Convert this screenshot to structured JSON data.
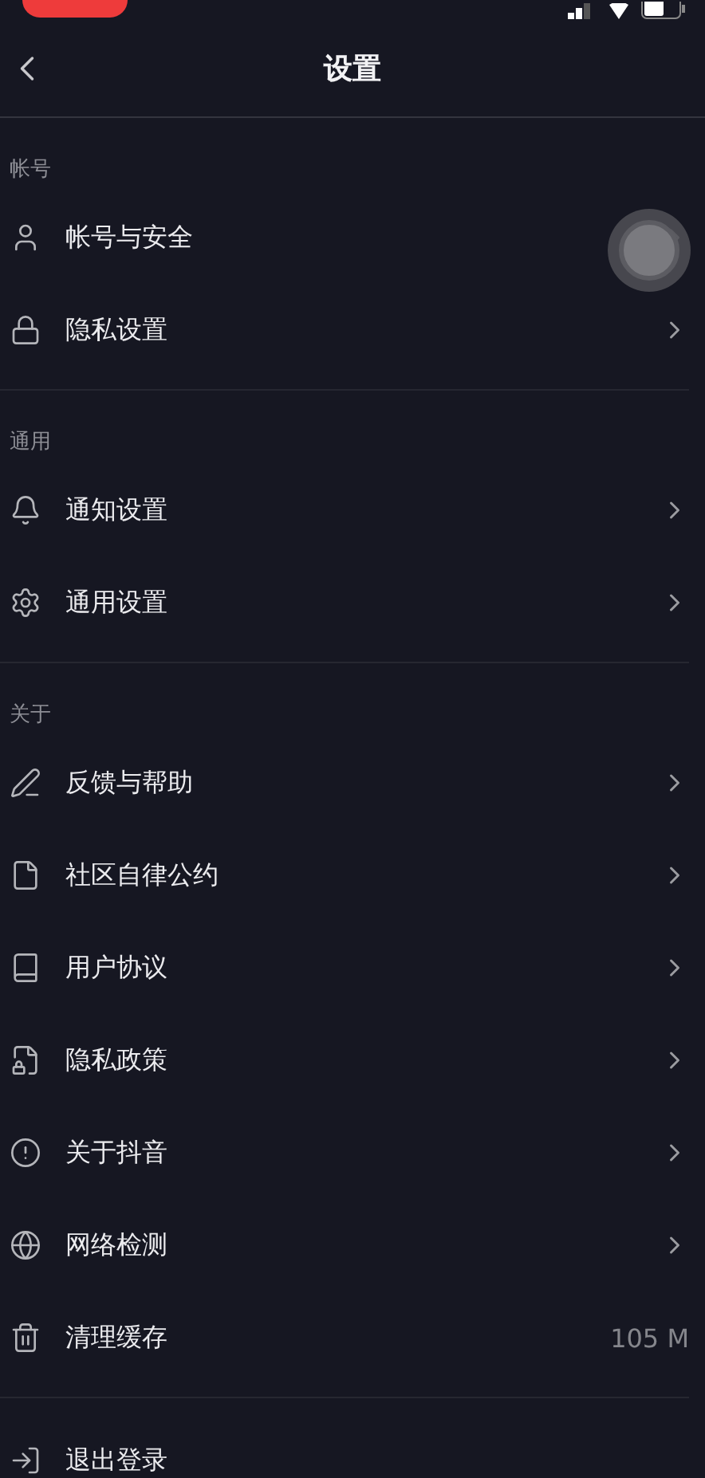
{
  "nav": {
    "title": "设置"
  },
  "sections": [
    {
      "title": "帐号",
      "items": [
        {
          "kind": "link",
          "label": "帐号与安全"
        },
        {
          "kind": "link",
          "label": "隐私设置"
        }
      ]
    },
    {
      "title": "通用",
      "items": [
        {
          "kind": "link",
          "label": "通知设置"
        },
        {
          "kind": "link",
          "label": "通用设置"
        }
      ]
    },
    {
      "title": "关于",
      "items": [
        {
          "kind": "link",
          "label": "反馈与帮助"
        },
        {
          "kind": "link",
          "label": "社区自律公约"
        },
        {
          "kind": "link",
          "label": "用户协议"
        },
        {
          "kind": "link",
          "label": "隐私政策"
        },
        {
          "kind": "link",
          "label": "关于抖音"
        },
        {
          "kind": "link",
          "label": "网络检测"
        },
        {
          "kind": "value",
          "label": "清理缓存",
          "value": "105 M"
        }
      ]
    },
    {
      "items": [
        {
          "kind": "plain",
          "label": "退出登录"
        }
      ]
    }
  ]
}
